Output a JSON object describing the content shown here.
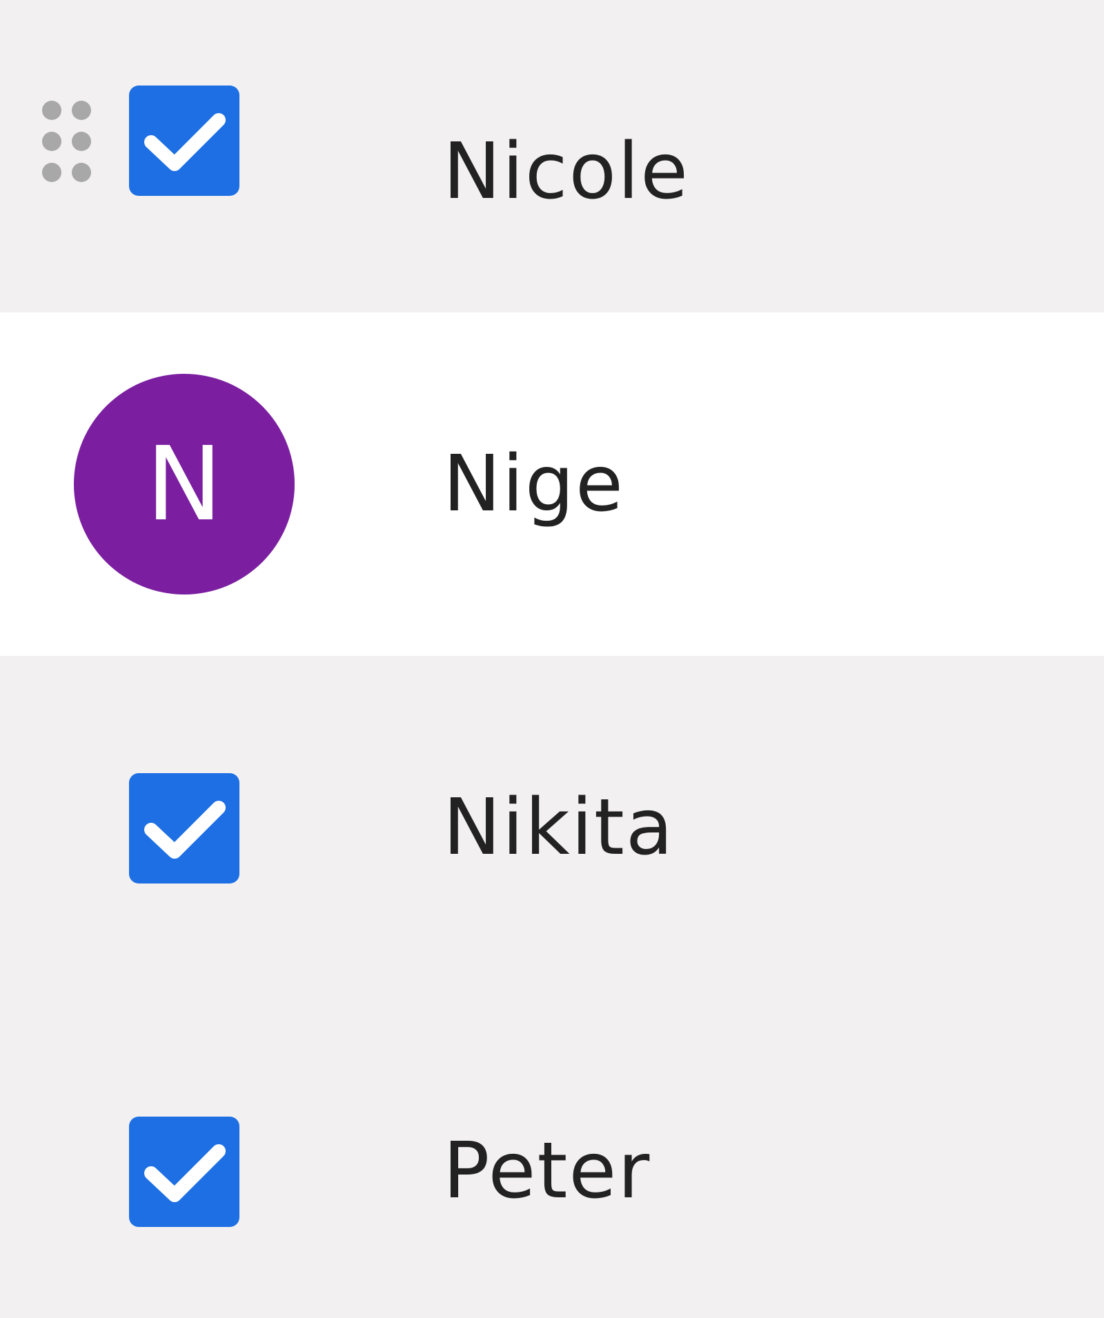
{
  "colors": {
    "row_background": "#f2f0f1",
    "highlight_row_background": "#ffffff",
    "checkbox": "#1d6fe3",
    "avatar": "#7b1fa0",
    "drag_handle": "#a8a8a8",
    "text": "#222222"
  },
  "contacts": [
    {
      "name": "Nicole",
      "checked": true,
      "icons": [
        "drag-handle-icon",
        "checkbox-checked"
      ]
    },
    {
      "name": "Nige",
      "avatar_initial": "N"
    },
    {
      "name": "Nikita",
      "checked": true
    },
    {
      "name": "Peter",
      "checked": true
    }
  ]
}
